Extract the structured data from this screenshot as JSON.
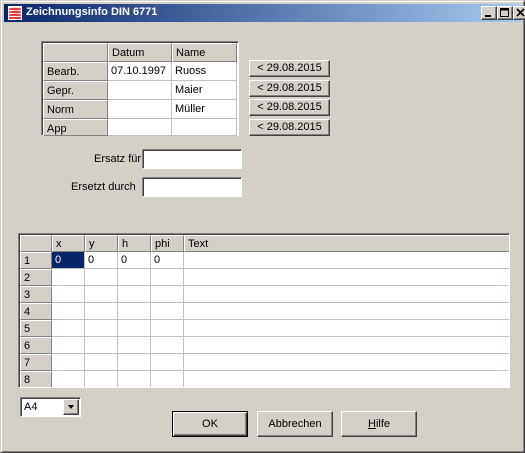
{
  "window": {
    "title": "Zeichnungsinfo DIN 6771",
    "icon": "layers-app-icon",
    "controls": {
      "minimize": "_",
      "maximize": "□",
      "close": "×"
    }
  },
  "signatures": {
    "headers": [
      "",
      "Datum",
      "Name"
    ],
    "rows": [
      {
        "role": "Bearb.",
        "datum": "07.10.1997",
        "name": "Ruoss",
        "button": "< 29.08.2015"
      },
      {
        "role": "Gepr.",
        "datum": "",
        "name": "Maier",
        "button": "< 29.08.2015"
      },
      {
        "role": "Norm",
        "datum": "",
        "name": "Müller",
        "button": "< 29.08.2015"
      },
      {
        "role": "App",
        "datum": "",
        "name": "",
        "button": "< 29.08.2015"
      }
    ]
  },
  "fields": {
    "ersatz_fuer": {
      "label": "Ersatz für",
      "value": ""
    },
    "ersetzt_durch": {
      "label": "Ersetzt durch",
      "value": ""
    }
  },
  "text_table": {
    "headers": [
      "",
      "x",
      "y",
      "h",
      "phi",
      "Text"
    ],
    "rows": [
      [
        "1",
        "0",
        "0",
        "0",
        "0",
        ""
      ],
      [
        "2",
        "",
        "",
        "",
        "",
        ""
      ],
      [
        "3",
        "",
        "",
        "",
        "",
        ""
      ],
      [
        "4",
        "",
        "",
        "",
        "",
        ""
      ],
      [
        "5",
        "",
        "",
        "",
        "",
        ""
      ],
      [
        "6",
        "",
        "",
        "",
        "",
        ""
      ],
      [
        "7",
        "",
        "",
        "",
        "",
        ""
      ],
      [
        "8",
        "",
        "",
        "",
        "",
        ""
      ]
    ]
  },
  "paper_format": {
    "selected": "A4"
  },
  "buttons": {
    "ok": "OK",
    "cancel": "Abbrechen",
    "help_prefix": "",
    "help_mnemonic": "H",
    "help_rest": "ilfe"
  }
}
